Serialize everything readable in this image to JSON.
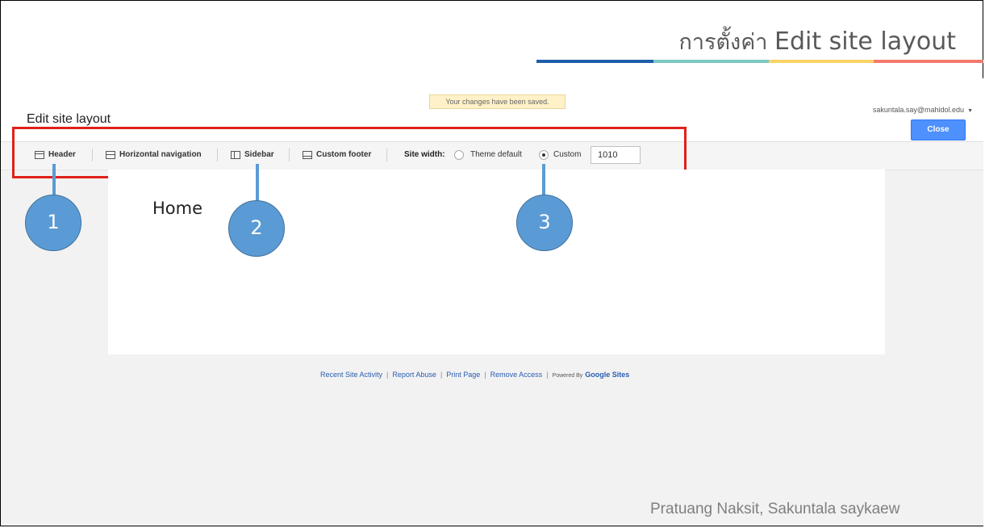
{
  "slide": {
    "title_prefix": "การตั้งค่า",
    "title_main": "Edit site layout",
    "credit": "Pratuang Naksit, Sakuntala  saykaew",
    "colors": {
      "bar": [
        "#1f5ea8",
        "#7dc8c2",
        "#fbd266",
        "#f47a6e"
      ],
      "callout": "#5b9bd5",
      "highlight": "#e0201a"
    }
  },
  "app": {
    "saved_message": "Your changes have been saved.",
    "page_title": "Edit site layout",
    "account": "sakuntala.say@mahidol.edu",
    "close_label": "Close"
  },
  "toolbar": {
    "items": [
      {
        "label": "Header",
        "icon": "header-layout-icon"
      },
      {
        "label": "Horizontal navigation",
        "icon": "navigation-layout-icon"
      },
      {
        "label": "Sidebar",
        "icon": "sidebar-layout-icon"
      },
      {
        "label": "Custom footer",
        "icon": "footer-layout-icon"
      }
    ],
    "site_width_label": "Site width:",
    "option_theme": "Theme default",
    "option_custom": "Custom",
    "selected_option": "Custom",
    "width_value": "1010"
  },
  "page": {
    "heading": "Home"
  },
  "footer": {
    "links": [
      "Recent Site Activity",
      "Report Abuse",
      "Print Page",
      "Remove Access"
    ],
    "powered_by": "Powered By",
    "brand": "Google Sites"
  },
  "callouts": [
    "1",
    "2",
    "3"
  ]
}
